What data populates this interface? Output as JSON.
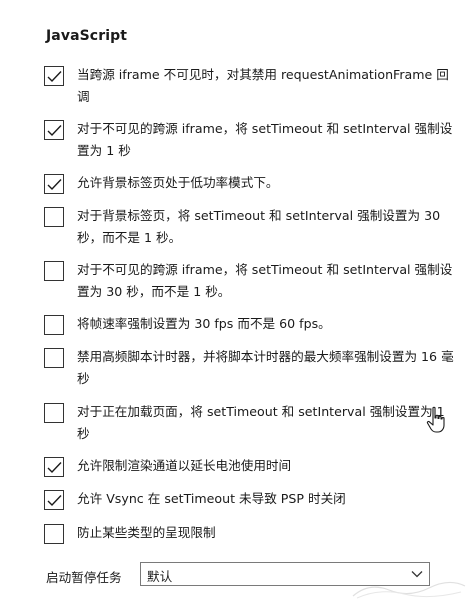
{
  "section": {
    "title": "JavaScript"
  },
  "options": [
    {
      "label": "当跨源 iframe 不可见时，对其禁用 requestAnimationFrame 回调",
      "checked": true
    },
    {
      "label": "对于不可见的跨源 iframe，将 setTimeout 和 setInterval 强制设置为 1 秒",
      "checked": true
    },
    {
      "label": "允许背景标签页处于低功率模式下。",
      "checked": true
    },
    {
      "label": "对于背景标签页，将 setTimeout 和 setInterval 强制设置为 30 秒，而不是 1 秒。",
      "checked": false
    },
    {
      "label": "对于不可见的跨源 iframe，将 setTimeout 和 setInterval 强制设置为 30 秒，而不是 1 秒。",
      "checked": false
    },
    {
      "label": "将帧速率强制设置为 30 fps 而不是 60 fps。",
      "checked": false
    },
    {
      "label": "禁用高频脚本计时器，并将脚本计时器的最大频率强制设置为 16 毫秒",
      "checked": false
    },
    {
      "label": "对于正在加载页面，将 setTimeout 和 setInterval 强制设置为 1 秒",
      "checked": false
    },
    {
      "label": "允许限制渲染通道以延长电池使用时间",
      "checked": true
    },
    {
      "label": "允许 Vsync 在 setTimeout 未导致 PSP 时关闭",
      "checked": true
    },
    {
      "label": "防止某些类型的呈现限制",
      "checked": false
    }
  ],
  "pause_tasks": {
    "label": "启动暂停任务",
    "selected": "默认"
  },
  "colors": {
    "text": "#1a1a1a",
    "checkbox_border": "#333333",
    "check_mark": "#1a1a1a",
    "dropdown_border": "#7a7a7a"
  },
  "icons": {
    "check": "check-icon",
    "dropdown": "chevron-down-icon",
    "cursor": "hand-pointer-icon"
  }
}
